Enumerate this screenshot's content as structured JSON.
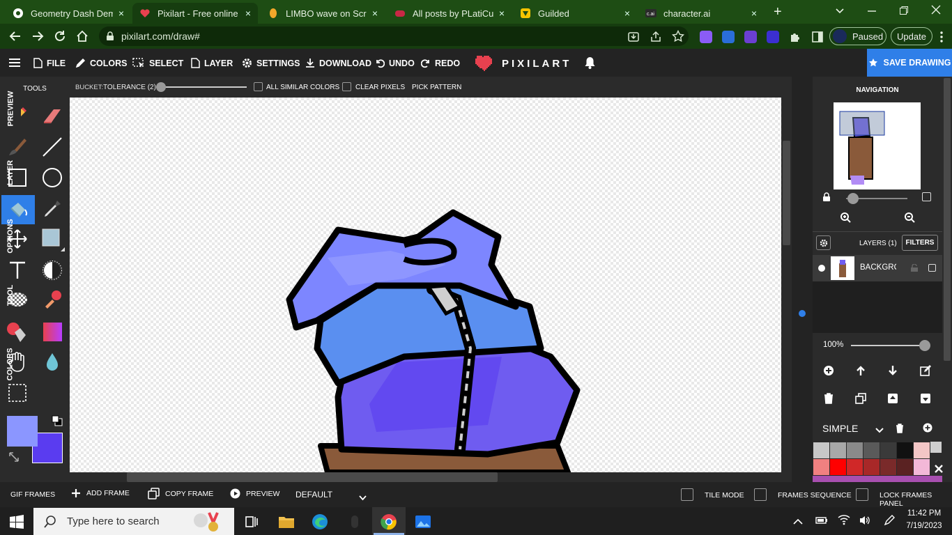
{
  "browser": {
    "tabs": [
      {
        "title": "Geometry Dash Demo",
        "fav_color": "#ffffff"
      },
      {
        "title": "Pixilart - Free online pi",
        "fav_color": "#e8414f"
      },
      {
        "title": "LIMBO wave on Scratc",
        "fav_color": "#f2a72a"
      },
      {
        "title": "All posts by PLatiCusT",
        "fav_color": "#c82845"
      },
      {
        "title": "Guilded",
        "fav_color": "#f5c400"
      },
      {
        "title": "character.ai",
        "fav_color": "#2b2b2b"
      }
    ],
    "close_glyph": "×",
    "new_tab_glyph": "+",
    "url": "pixilart.com/draw#",
    "paused_label": "Paused",
    "update_label": "Update"
  },
  "app": {
    "menu": [
      {
        "icon": "file-icon",
        "label": "FILE"
      },
      {
        "icon": "colors-icon",
        "label": "COLORS"
      },
      {
        "icon": "select-icon",
        "label": "SELECT"
      },
      {
        "icon": "layer-icon",
        "label": "LAYER"
      },
      {
        "icon": "settings-icon",
        "label": "SETTINGS"
      },
      {
        "icon": "download-icon",
        "label": "DOWNLOAD"
      },
      {
        "icon": "undo-icon",
        "label": "UNDO"
      },
      {
        "icon": "redo-icon",
        "label": "REDO"
      }
    ],
    "logo_text": "PIXILART",
    "save_label": "SAVE DRAWING",
    "tools_heading": "TOOLS",
    "primary_color": "#8b96ff",
    "secondary_color": "#5a3cf0"
  },
  "options": {
    "tool_label": "BUCKET:",
    "tolerance_label": "TOLERANCE (2)",
    "tolerance_fraction": 0.05,
    "all_similar_label": "ALL SIMILAR COLORS",
    "clear_pixels_label": "CLEAR PIXELS",
    "pick_pattern_label": "PICK PATTERN"
  },
  "side_tabs": [
    "PREVIEW",
    "LAYER",
    "OPTIONS",
    "TOOL",
    "COLORS"
  ],
  "panel": {
    "navigation_title": "NAVIGATION",
    "layers_label": "LAYERS (1)",
    "filters_label": "FILTERS",
    "layer_name": "BACKGROUI",
    "zoom_label": "100%",
    "palette_name": "SIMPLE",
    "palette": [
      "#c8c8c8",
      "#a8a8a8",
      "#8a8a8a",
      "#5a5a5a",
      "#3a3a3a",
      "#111111",
      "#f3c6c6",
      "#f08080",
      "#ff0000",
      "#d02828",
      "#a82828",
      "#7a2a2a",
      "#5a2222",
      "#f3b8d8"
    ]
  },
  "frames": {
    "gif_frames_label": "GIF FRAMES",
    "add_frame_label": "ADD FRAME",
    "copy_frame_label": "COPY FRAME",
    "preview_label": "PREVIEW",
    "default_label": "DEFAULT",
    "tile_mode_label": "TILE MODE",
    "frames_sequence_label": "FRAMES SEQUENCE",
    "lock_frames_label": "LOCK FRAMES PANEL"
  },
  "taskbar": {
    "search_placeholder": "Type here to search",
    "time": "11:42 PM",
    "date": "7/19/2023"
  }
}
